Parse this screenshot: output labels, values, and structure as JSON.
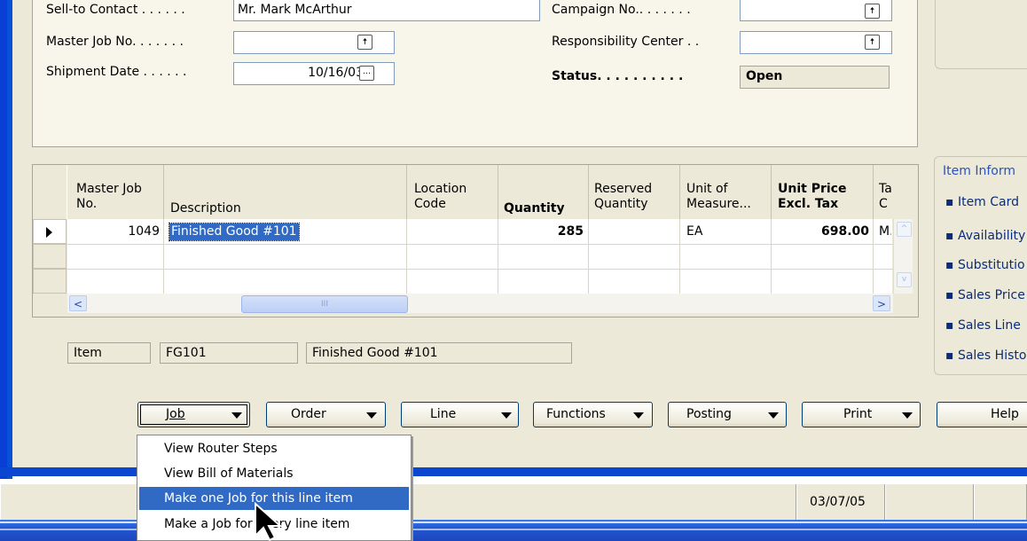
{
  "header": {
    "sell_to_contact_label": "Sell-to Contact . . . . . .",
    "sell_to_contact_value": "Mr. Mark McArthur",
    "master_job_label": "Master Job No. . . . . . .",
    "master_job_value": "",
    "shipment_date_label": "Shipment Date . . . . . .",
    "shipment_date_value": "10/16/03",
    "campaign_label": "Campaign No.. . . . . . .",
    "campaign_value": "",
    "resp_center_label": "Responsibility Center . .",
    "resp_center_value": "",
    "status_label": "Status. . . . . . . . . .",
    "status_value": "Open"
  },
  "grid": {
    "columns": {
      "master_job": [
        "Master Job",
        "No."
      ],
      "description": "Description",
      "location": [
        "Location",
        "Code"
      ],
      "quantity": "Quantity",
      "reserved": [
        "Reserved",
        "Quantity"
      ],
      "unit": [
        "Unit of",
        "Measure..."
      ],
      "unit_price": [
        "Unit Price",
        "Excl. Tax"
      ],
      "tax": [
        "Ta",
        "C"
      ]
    },
    "row1": {
      "master_job": "1049",
      "description": "Finished Good #101",
      "location": "",
      "quantity": "285",
      "reserved": "",
      "unit": "EA",
      "unit_price": "698.00",
      "tax": "M."
    },
    "scroll_thumb": "III"
  },
  "info_bar": {
    "type": "Item",
    "no": "FG101",
    "description": "Finished Good #101"
  },
  "side_panel": {
    "title": "Item Inform",
    "items": [
      "Item Card",
      "Availability",
      "Substitutio",
      "Sales Price",
      "Sales Line",
      "Sales Histo"
    ]
  },
  "buttons": {
    "job": "Job",
    "order": "Order",
    "line": "Line",
    "functions": "Functions",
    "posting": "Posting",
    "print": "Print",
    "help": "Help"
  },
  "menu": {
    "items": [
      "View Router Steps",
      "View Bill of Materials",
      "Make one Job for this line item",
      "Make a Job for every line item"
    ]
  },
  "statusbar": {
    "date": "03/07/05"
  },
  "colors": {
    "selection": "#316ac5",
    "window_border": "#0a3fd6",
    "face": "#ece9d8"
  }
}
